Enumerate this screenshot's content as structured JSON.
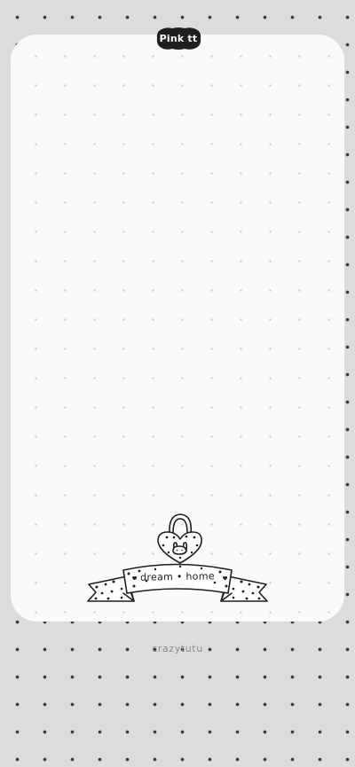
{
  "badge": {
    "label": "Pink tt"
  },
  "artwork": {
    "ribbon_text": "dream • home"
  },
  "footer": {
    "credit": "crazytutu"
  }
}
